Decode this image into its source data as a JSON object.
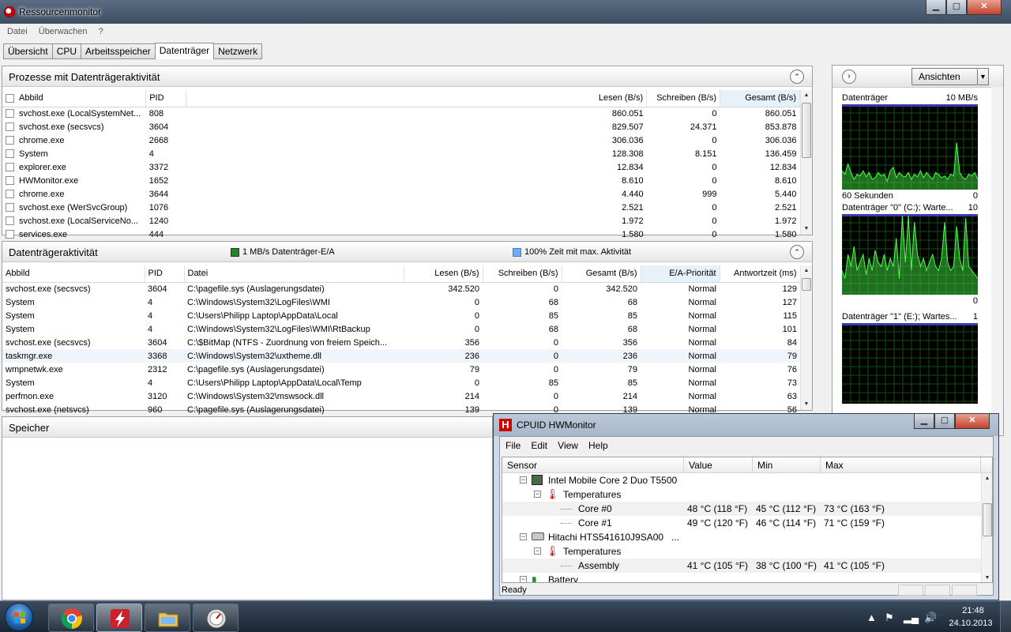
{
  "rm": {
    "title": "Ressourcenmonitor",
    "window_buttons": {
      "min": "▁",
      "max": "▢",
      "close": "✕"
    },
    "menu": [
      "Datei",
      "Überwachen",
      "?"
    ],
    "tabs": [
      "Übersicht",
      "CPU",
      "Arbeitsspeicher",
      "Datenträger",
      "Netzwerk"
    ],
    "active_tab": "Datenträger",
    "processes": {
      "title": "Prozesse mit Datenträgeraktivität",
      "columns": [
        "Abbild",
        "PID",
        "Lesen (B/s)",
        "Schreiben (B/s)",
        "Gesamt (B/s)"
      ],
      "rows": [
        [
          "svchost.exe (LocalSystemNet...",
          "808",
          "860.051",
          "0",
          "860.051"
        ],
        [
          "svchost.exe (secsvcs)",
          "3604",
          "829.507",
          "24.371",
          "853.878"
        ],
        [
          "chrome.exe",
          "2668",
          "306.036",
          "0",
          "306.036"
        ],
        [
          "System",
          "4",
          "128.308",
          "8.151",
          "136.459"
        ],
        [
          "explorer.exe",
          "3372",
          "12.834",
          "0",
          "12.834"
        ],
        [
          "HWMonitor.exe",
          "1652",
          "8.610",
          "0",
          "8.610"
        ],
        [
          "chrome.exe",
          "3644",
          "4.440",
          "999",
          "5.440"
        ],
        [
          "svchost.exe (WerSvcGroup)",
          "1076",
          "2.521",
          "0",
          "2.521"
        ],
        [
          "svchost.exe (LocalServiceNo...",
          "1240",
          "1.972",
          "0",
          "1.972"
        ],
        [
          "services.exe",
          "444",
          "1.580",
          "0",
          "1.580"
        ]
      ]
    },
    "activity": {
      "title": "Datenträgeraktivität",
      "legend1": "1 MB/s Datenträger-E/A",
      "legend2": "100% Zeit mit max. Aktivität",
      "legend1_color": "#1e8a1e",
      "legend2_color": "#6ab0f0",
      "columns": [
        "Abbild",
        "PID",
        "Datei",
        "Lesen (B/s)",
        "Schreiben (B/s)",
        "Gesamt (B/s)",
        "E/A-Priorität",
        "Antwortzeit (ms)"
      ],
      "rows": [
        [
          "svchost.exe (secsvcs)",
          "3604",
          "C:\\pagefile.sys (Auslagerungsdatei)",
          "342.520",
          "0",
          "342.520",
          "Normal",
          "129"
        ],
        [
          "System",
          "4",
          "C:\\Windows\\System32\\LogFiles\\WMI",
          "0",
          "68",
          "68",
          "Normal",
          "127"
        ],
        [
          "System",
          "4",
          "C:\\Users\\Philipp Laptop\\AppData\\Local",
          "0",
          "85",
          "85",
          "Normal",
          "115"
        ],
        [
          "System",
          "4",
          "C:\\Windows\\System32\\LogFiles\\WMI\\RtBackup",
          "0",
          "68",
          "68",
          "Normal",
          "101"
        ],
        [
          "svchost.exe (secsvcs)",
          "3604",
          "C:\\$BitMap (NTFS - Zuordnung von freiem Speich...",
          "356",
          "0",
          "356",
          "Normal",
          "84"
        ],
        [
          "taskmgr.exe",
          "3368",
          "C:\\Windows\\System32\\uxtheme.dll",
          "236",
          "0",
          "236",
          "Normal",
          "79"
        ],
        [
          "wmpnetwk.exe",
          "2312",
          "C:\\pagefile.sys (Auslagerungsdatei)",
          "79",
          "0",
          "79",
          "Normal",
          "76"
        ],
        [
          "System",
          "4",
          "C:\\Users\\Philipp Laptop\\AppData\\Local\\Temp",
          "0",
          "85",
          "85",
          "Normal",
          "73"
        ],
        [
          "perfmon.exe",
          "3120",
          "C:\\Windows\\System32\\mswsock.dll",
          "214",
          "0",
          "214",
          "Normal",
          "63"
        ],
        [
          "svchost.exe (netsvcs)",
          "960",
          "C:\\pagefile.sys (Auslagerungsdatei)",
          "139",
          "0",
          "139",
          "Normal",
          "56"
        ]
      ]
    },
    "memory": {
      "title": "Speicher"
    },
    "graphs": {
      "views_label": "Ansichten",
      "graph1": {
        "label": "Datenträger",
        "max": "10 MB/s",
        "bottom_left": "60 Sekunden",
        "bottom_right": "0"
      },
      "graph2": {
        "label": "Datenträger \"0\" (C:); Warte...",
        "max": "10",
        "bottom_right": "0"
      },
      "graph3": {
        "label": "Datenträger \"1\" (E:); Wartes...",
        "max": "1"
      }
    }
  },
  "hw": {
    "title": "CPUID HWMonitor",
    "icon_letter": "H",
    "menu": [
      "File",
      "Edit",
      "View",
      "Help"
    ],
    "columns": [
      "Sensor",
      "Value",
      "Min",
      "Max"
    ],
    "rows": {
      "cpu": "Intel Mobile Core 2 Duo T5500",
      "cpu_temps": "Temperatures",
      "core0": {
        "name": "Core #0",
        "value": "48 °C  (118 °F)",
        "min": "45 °C  (112 °F)",
        "max": "73 °C  (163 °F)"
      },
      "core1": {
        "name": "Core #1",
        "value": "49 °C  (120 °F)",
        "min": "46 °C  (114 °F)",
        "max": "71 °C  (159 °F)"
      },
      "hdd": "Hitachi HTS541610J9SA00",
      "hdd_ellipsis": "...",
      "hdd_temps": "Temperatures",
      "assembly": {
        "name": "Assembly",
        "value": "41 °C  (105 °F)",
        "min": "38 °C  (100 °F)",
        "max": "41 °C  (105 °F)"
      },
      "battery": "Battery"
    },
    "status": "Ready"
  },
  "taskbar": {
    "time": "21:48",
    "date": "24.10.2013"
  }
}
